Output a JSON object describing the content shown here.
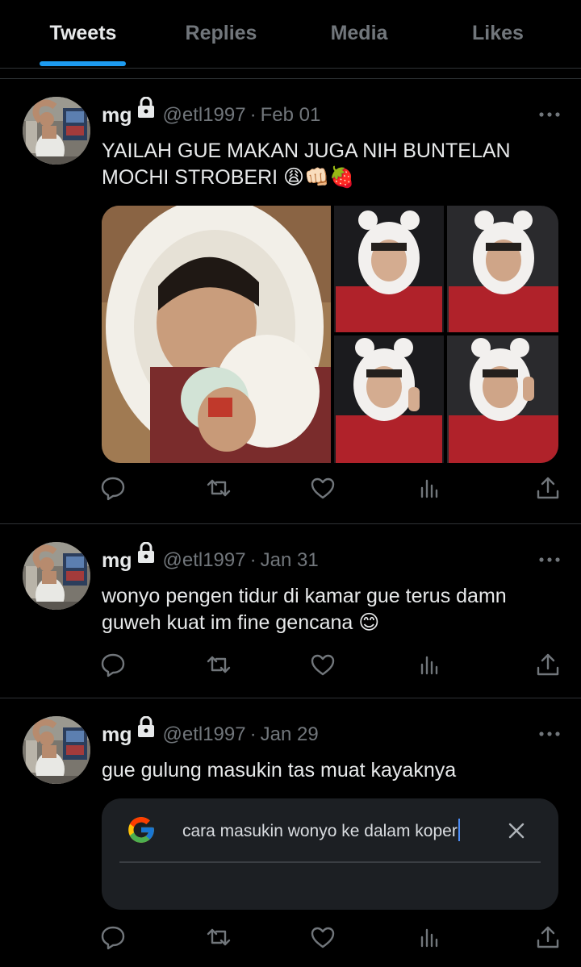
{
  "tabs": [
    {
      "label": "Tweets",
      "active": true
    },
    {
      "label": "Replies",
      "active": false
    },
    {
      "label": "Media",
      "active": false
    },
    {
      "label": "Likes",
      "active": false
    }
  ],
  "colors": {
    "accent": "#1d9bf0",
    "background": "#000000",
    "text_primary": "#e7e9ea",
    "text_secondary": "#71767b"
  },
  "tweets": [
    {
      "name": "mg",
      "handle": "@etl1997",
      "separator": "·",
      "date": "Feb 01",
      "text": "YAILAH GUE MAKAN JUGA NIH BUNTELAN MOCHI STROBERI 😩👊🏻🍓",
      "media": [
        "photo-hood-selfie",
        "photo-red-jacket-1",
        "photo-red-jacket-2",
        "photo-red-jacket-3",
        "photo-red-jacket-4"
      ]
    },
    {
      "name": "mg",
      "handle": "@etl1997",
      "separator": "·",
      "date": "Jan 31",
      "text": "wonyo pengen tidur di kamar gue terus damn guweh kuat im fine gencana 😊"
    },
    {
      "name": "mg",
      "handle": "@etl1997",
      "separator": "·",
      "date": "Jan 29",
      "text": "gue gulung masukin tas muat kayaknya",
      "search_card": {
        "query": "cara masukin wonyo ke dalam koper",
        "logo": "google-g-logo"
      }
    }
  ],
  "icons": {
    "lock": "lock-icon",
    "more": "more-horizontal-icon",
    "reply": "reply-icon",
    "retweet": "retweet-icon",
    "like": "heart-icon",
    "views": "views-icon",
    "share": "share-icon",
    "close": "close-icon"
  }
}
